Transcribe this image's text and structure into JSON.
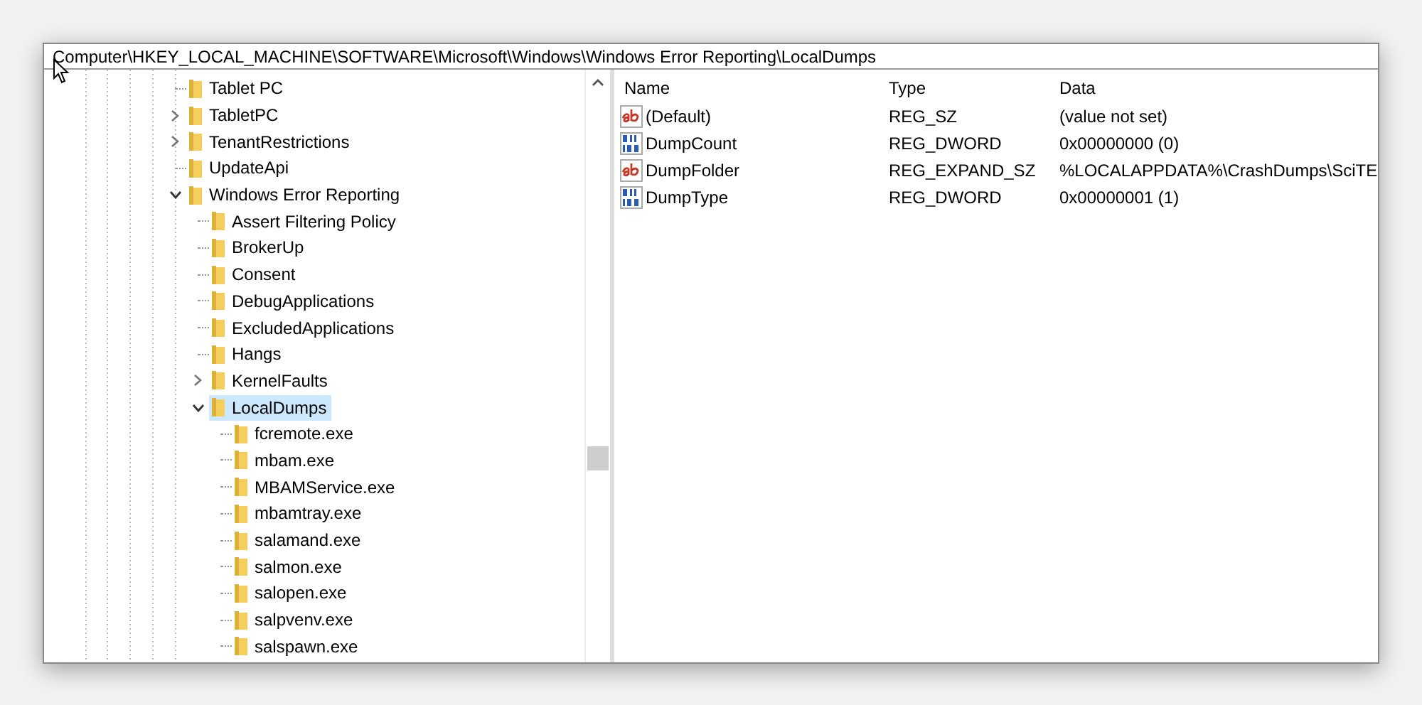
{
  "address_bar": {
    "path": "Computer\\HKEY_LOCAL_MACHINE\\SOFTWARE\\Microsoft\\Windows\\Windows Error Reporting\\LocalDumps"
  },
  "tree": [
    {
      "label": "Tablet PC",
      "kind": "leaf",
      "selected": false
    },
    {
      "label": "TabletPC",
      "kind": "branch",
      "expanded": false,
      "selected": false
    },
    {
      "label": "TenantRestrictions",
      "kind": "branch",
      "expanded": false,
      "selected": false
    },
    {
      "label": "UpdateApi",
      "kind": "leaf",
      "selected": false
    },
    {
      "label": "Windows Error Reporting",
      "kind": "branch",
      "expanded": true,
      "selected": false,
      "children": [
        {
          "label": "Assert Filtering Policy",
          "kind": "leaf",
          "selected": false
        },
        {
          "label": "BrokerUp",
          "kind": "leaf",
          "selected": false
        },
        {
          "label": "Consent",
          "kind": "leaf",
          "selected": false
        },
        {
          "label": "DebugApplications",
          "kind": "leaf",
          "selected": false
        },
        {
          "label": "ExcludedApplications",
          "kind": "leaf",
          "selected": false
        },
        {
          "label": "Hangs",
          "kind": "leaf",
          "selected": false
        },
        {
          "label": "KernelFaults",
          "kind": "branch",
          "expanded": false,
          "selected": false
        },
        {
          "label": "LocalDumps",
          "kind": "branch",
          "expanded": true,
          "selected": true,
          "children": [
            {
              "label": "fcremote.exe",
              "kind": "leaf",
              "selected": false
            },
            {
              "label": "mbam.exe",
              "kind": "leaf",
              "selected": false
            },
            {
              "label": "MBAMService.exe",
              "kind": "leaf",
              "selected": false
            },
            {
              "label": "mbamtray.exe",
              "kind": "leaf",
              "selected": false
            },
            {
              "label": "salamand.exe",
              "kind": "leaf",
              "selected": false
            },
            {
              "label": "salmon.exe",
              "kind": "leaf",
              "selected": false
            },
            {
              "label": "salopen.exe",
              "kind": "leaf",
              "selected": false
            },
            {
              "label": "salpvenv.exe",
              "kind": "leaf",
              "selected": false
            },
            {
              "label": "salspawn.exe",
              "kind": "leaf",
              "selected": false
            }
          ]
        }
      ]
    }
  ],
  "values": {
    "columns": [
      "Name",
      "Type",
      "Data"
    ],
    "rows": [
      {
        "kind": "string",
        "name": "(Default)",
        "type": "REG_SZ",
        "data": "(value not set)"
      },
      {
        "kind": "binary",
        "name": "DumpCount",
        "type": "REG_DWORD",
        "data": "0x00000000 (0)"
      },
      {
        "kind": "string",
        "name": "DumpFolder",
        "type": "REG_EXPAND_SZ",
        "data": "%LOCALAPPDATA%\\CrashDumps\\SciTE"
      },
      {
        "kind": "binary",
        "name": "DumpType",
        "type": "REG_DWORD",
        "data": "0x00000001 (1)"
      }
    ]
  }
}
